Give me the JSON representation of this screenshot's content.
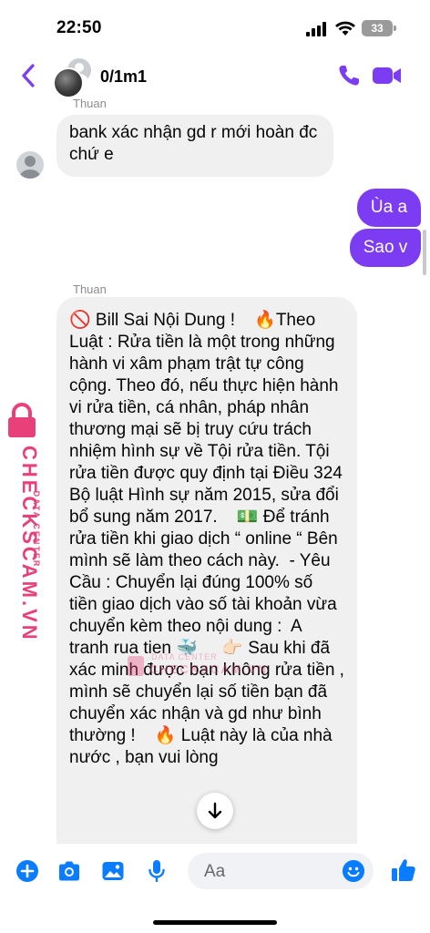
{
  "status_bar": {
    "time": "22:50",
    "battery": "33"
  },
  "header": {
    "contact_name": "0/1m1"
  },
  "messages": {
    "sender_1": "Thuan",
    "incoming_1": "bank xác nhận gd r mới hoàn đc chứ e",
    "outgoing_1": "Ùa a",
    "outgoing_2": "Sao v",
    "sender_2": "Thuan",
    "incoming_2": "🚫 Bill Sai Nội Dung !    🔥Theo Luật : Rửa tiền là một trong những hành vi xâm phạm trật tự công cộng. Theo đó, nếu thực hiện hành vi rửa tiền, cá nhân, pháp nhân thương mại sẽ bị truy cứu trách nhiệm hình sự về Tội rửa tiền. Tội rửa tiền được quy định tại Điều 324 Bộ luật Hình sự năm 2015, sửa đổi bổ sung năm 2017.    💵 Để tránh rửa tiền khi giao dịch “ online “ Bên mình sẽ làm theo cách này.  - Yêu Cầu : Chuyển lại đúng 100% số tiền giao dịch vào số tài khoản vừa chuyển kèm theo nội dung :  A tranh rua tien 🐳     👉🏻 Sau khi đã xác minh được bạn không rửa tiền , mình sẽ chuyển lại số tiền bạn đã chuyển xác nhận và gd như bình thường !    🔥 Luật này là của nhà nước , bạn vui lòng"
  },
  "watermark": {
    "brand": "CHECKSCAM.VN",
    "tagline": "DATA CENTER",
    "color": "#e8417a"
  },
  "composer": {
    "placeholder": "Aa"
  },
  "colors": {
    "accent": "#7b3cf2",
    "messenger_blue": "#0a7cff",
    "bubble_in": "#f0f0f0"
  },
  "icons": {
    "back": "chevron-left-icon",
    "call": "phone-icon",
    "video": "video-camera-icon",
    "plus": "plus-circle-icon",
    "camera": "camera-icon",
    "gallery": "image-icon",
    "mic": "microphone-icon",
    "emoji": "smiley-icon",
    "like": "thumbs-up-icon",
    "scroll_down": "arrow-down-icon"
  }
}
